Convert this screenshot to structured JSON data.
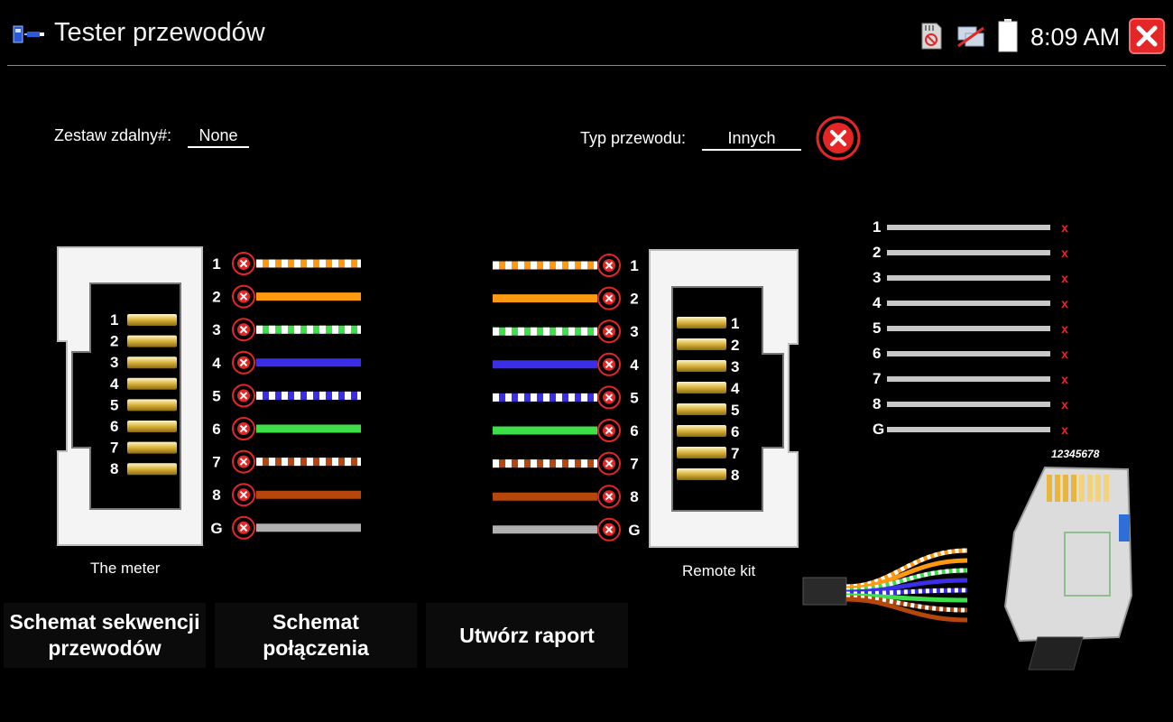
{
  "app": {
    "title": "Tester przewodów",
    "clock": "8:09 AM"
  },
  "info": {
    "remote_label": "Zestaw zdalny#:",
    "remote_value": "None",
    "type_label": "Typ przewodu:",
    "type_value": "Innych"
  },
  "left_connector": {
    "caption": "The meter",
    "pins": [
      "1",
      "2",
      "3",
      "4",
      "5",
      "6",
      "7",
      "8"
    ]
  },
  "right_connector": {
    "caption": "Remote kit",
    "pins": [
      "1",
      "2",
      "3",
      "4",
      "5",
      "6",
      "7",
      "8"
    ]
  },
  "wires": [
    {
      "label": "1",
      "color": "#ff9a10",
      "striped": true
    },
    {
      "label": "2",
      "color": "#ff9a10",
      "striped": false
    },
    {
      "label": "3",
      "color": "#3ee04a",
      "striped": true
    },
    {
      "label": "4",
      "color": "#3a2ee8",
      "striped": false
    },
    {
      "label": "5",
      "color": "#3a2ee8",
      "striped": true
    },
    {
      "label": "6",
      "color": "#3ee04a",
      "striped": false
    },
    {
      "label": "7",
      "color": "#b5460c",
      "striped": true
    },
    {
      "label": "8",
      "color": "#b5460c",
      "striped": false
    },
    {
      "label": "G",
      "color": "#b0b0b0",
      "striped": false
    }
  ],
  "wire_status": "fail",
  "result_list": {
    "rows": [
      "1",
      "2",
      "3",
      "4",
      "5",
      "6",
      "7",
      "8",
      "G"
    ],
    "mark": "x"
  },
  "plug_illustration": {
    "label": "12345678"
  },
  "buttons": {
    "sequence_line1": "Schemat sekwencji",
    "sequence_line2": "przewodów",
    "connection_line1": "Schemat",
    "connection_line2": "połączenia",
    "report": "Utwórz raport"
  },
  "colors": {
    "error": "#e52626",
    "background": "#000000"
  }
}
